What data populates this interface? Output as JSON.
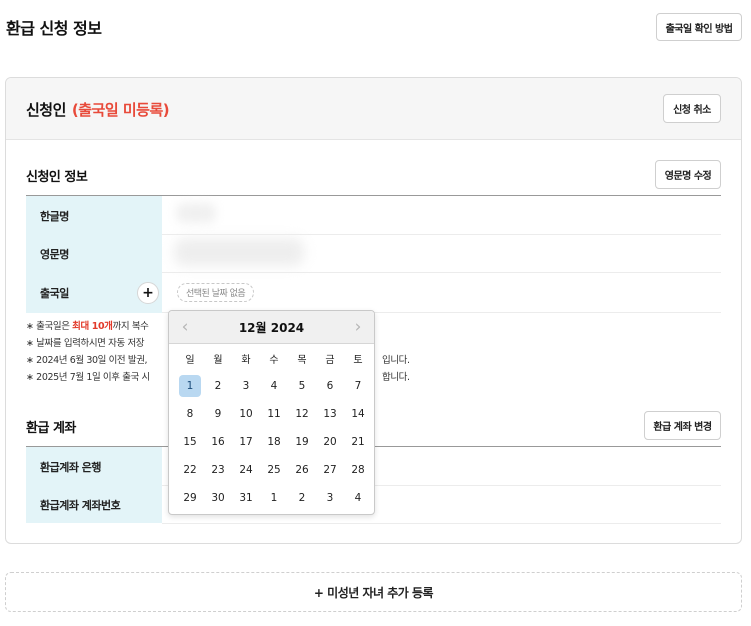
{
  "header": {
    "title": "환급 신청 정보",
    "howto_button": "출국일 확인 방법"
  },
  "applicant": {
    "title": "신청인",
    "status": "(출국일 미등록)",
    "cancel_button": "신청 취소",
    "info_section": {
      "title": "신청인 정보",
      "edit_english_name_button": "영문명 수정",
      "rows": [
        {
          "label": "한글명"
        },
        {
          "label": "영문명"
        },
        {
          "label": "출국일"
        }
      ],
      "add_date_symbol": "+",
      "date_placeholder": "선택된 날짜 없음"
    },
    "notes": {
      "line1_prefix": "∗ 출국일은 ",
      "line1_highlight": "최대 10개",
      "line1_suffix": "까지 복수 ",
      "line2": "∗ 날짜를 입력하시면 자동 저장 ",
      "line3": "∗ 2024년 6월 30일 이전 발권,",
      "line3_tail": "입니다.",
      "line4": "∗ 2025년 7월 1일 이후 출국 시",
      "line4_tail": "합니다."
    },
    "account_section": {
      "title": "환급 계좌",
      "change_button": "환급 계좌 변경",
      "rows": [
        {
          "label": "환급계좌 은행"
        },
        {
          "label": "환급계좌 계좌번호"
        }
      ]
    }
  },
  "add_child_button": "+ 미성년 자녀 추가 등록",
  "datepicker": {
    "month_label": "12월 2024",
    "prev_symbol": "‹",
    "next_symbol": "›",
    "weekdays": [
      "일",
      "월",
      "화",
      "수",
      "목",
      "금",
      "토"
    ],
    "days": [
      1,
      2,
      3,
      4,
      5,
      6,
      7,
      8,
      9,
      10,
      11,
      12,
      13,
      14,
      15,
      16,
      17,
      18,
      19,
      20,
      21,
      22,
      23,
      24,
      25,
      26,
      27,
      28,
      29,
      30,
      31,
      1,
      2,
      3,
      4
    ],
    "selected_day": 1,
    "selected_color": "#b9d8f1"
  },
  "colors": {
    "accent_red": "#e84a3a",
    "label_bg": "#e3f4f8"
  }
}
